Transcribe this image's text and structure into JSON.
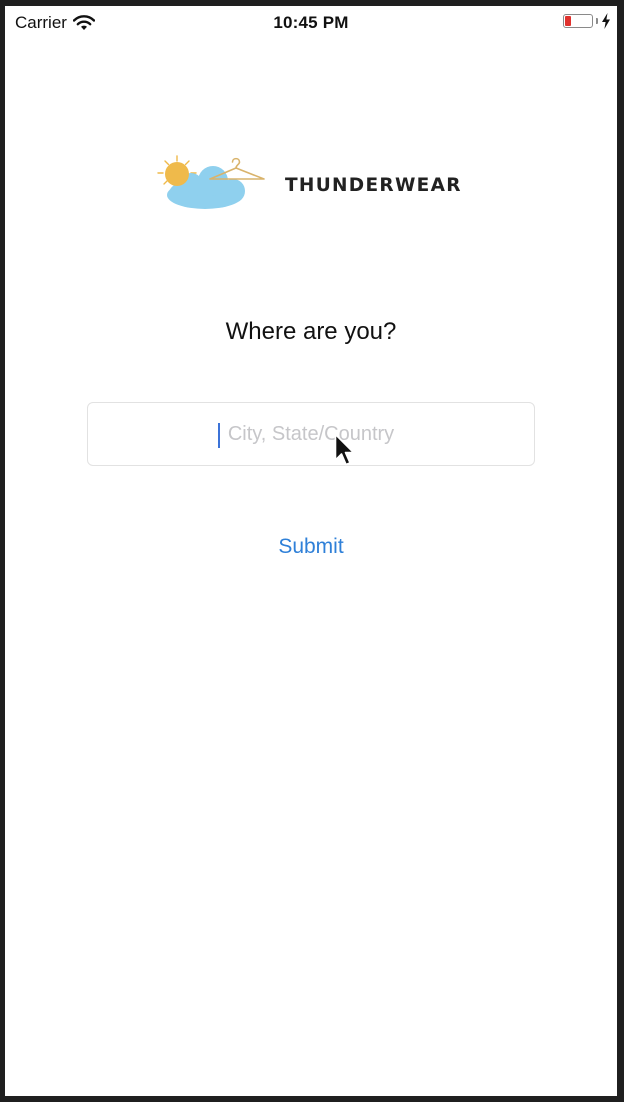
{
  "status_bar": {
    "carrier": "Carrier",
    "time": "10:45 PM",
    "battery_level": 0.2,
    "battery_color": "#e0322e",
    "icons": [
      "wifi-icon",
      "battery-icon",
      "charging-bolt-icon"
    ]
  },
  "logo": {
    "brand_name": "THUNDERWEAR",
    "graphic": "sun-cloud-hanger-logo",
    "colors": {
      "sun": "#efba4b",
      "cloud": "#8fd0ee",
      "hanger": "#d9b36b"
    }
  },
  "main": {
    "prompt": "Where are you?",
    "location_input": {
      "placeholder": "City, State/Country",
      "value": ""
    },
    "submit_label": "Submit",
    "accent_color": "#2f80d8"
  }
}
